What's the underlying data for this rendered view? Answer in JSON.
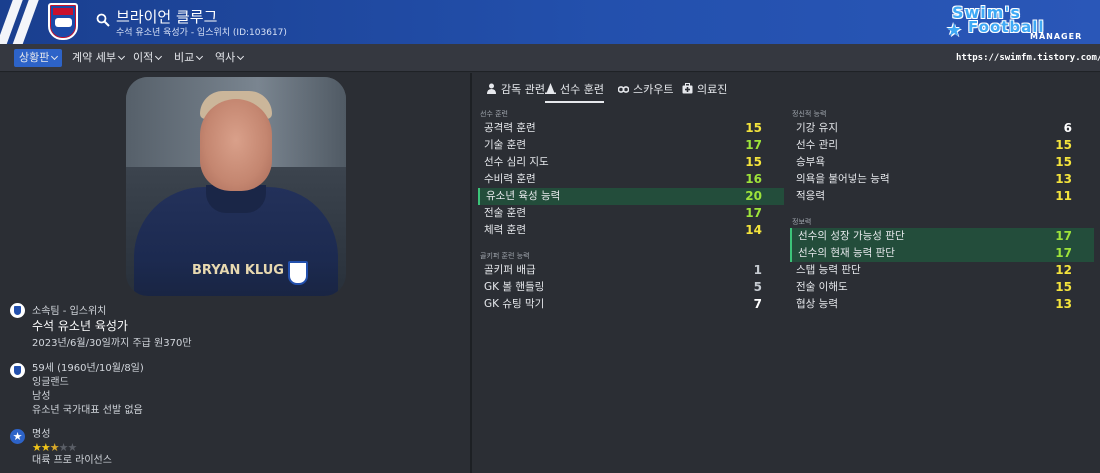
{
  "header": {
    "name": "브라이언 클루그",
    "subtitle": "수석 유소년 육성가 - 입스위치 (ID:103617)",
    "logo_line1": "Swim's",
    "logo_line2": "Football",
    "logo_line3": "MANAGER",
    "accent": "#2350ad"
  },
  "nav": {
    "items": [
      "상황판",
      "계약 세부",
      "이적",
      "비교",
      "역사"
    ],
    "url": "https://swimfm.tistory.com/"
  },
  "profile": {
    "shirt_print": "BRYAN KLUG",
    "club_line": "소속팀 - 입스위치",
    "role": "수석 유소년 육성가",
    "contract": "2023년/6월/30일까지 주급 원370만",
    "age": "59세 (1960년/10월/8일)",
    "nation": "잉글랜드",
    "gender": "남성",
    "caps": "유소년 국가대표 선발 없음",
    "reputation_label": "명성",
    "reputation_stars": 2.5,
    "license": "대륙 프로 라이선스"
  },
  "tabs": [
    "감독 관련",
    "선수 훈련",
    "스카우트",
    "의료진"
  ],
  "training": {
    "label": "선수 훈련",
    "rows": [
      {
        "label": "공격력 훈련",
        "value": "15"
      },
      {
        "label": "기술 훈련",
        "value": "17"
      },
      {
        "label": "선수 심리 지도",
        "value": "15"
      },
      {
        "label": "수비력 훈련",
        "value": "16"
      },
      {
        "label": "유소년 육성 능력",
        "value": "20"
      },
      {
        "label": "전술 훈련",
        "value": "17"
      },
      {
        "label": "체력 훈련",
        "value": "14"
      }
    ]
  },
  "gk": {
    "label": "골키퍼 훈련 능력",
    "rows": [
      {
        "label": "골키퍼 배급",
        "value": "1"
      },
      {
        "label": "GK 볼 핸들링",
        "value": "5"
      },
      {
        "label": "GK 슈팅 막기",
        "value": "7"
      }
    ]
  },
  "mental": {
    "label": "정신적 능력",
    "rows": [
      {
        "label": "기강 유지",
        "value": "6"
      },
      {
        "label": "선수 관리",
        "value": "15"
      },
      {
        "label": "승부욕",
        "value": "15"
      },
      {
        "label": "의욕을 불어넣는 능력",
        "value": "13"
      },
      {
        "label": "적응력",
        "value": "11"
      }
    ]
  },
  "knowledge": {
    "label": "정보력",
    "rows": [
      {
        "label": "선수의 성장 가능성 판단",
        "value": "17"
      },
      {
        "label": "선수의 현재 능력 판단",
        "value": "17"
      },
      {
        "label": "스탭 능력 판단",
        "value": "12"
      },
      {
        "label": "전술 이해도",
        "value": "15"
      },
      {
        "label": "협상 능력",
        "value": "13"
      }
    ]
  }
}
